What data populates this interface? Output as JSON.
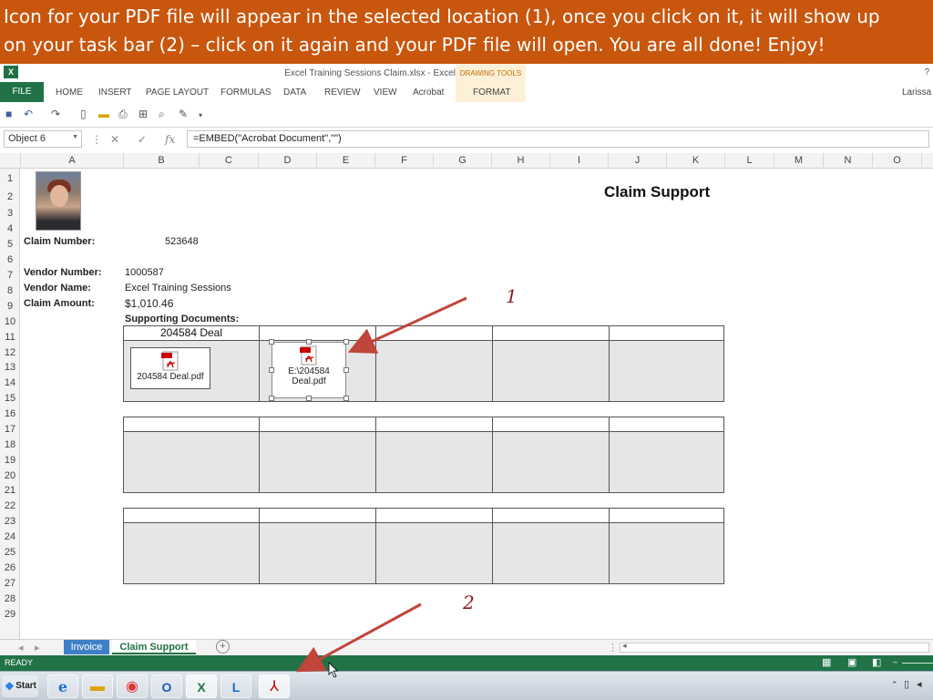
{
  "banner": {
    "line1": "Icon for your PDF file will appear in the selected location (1), once you click on it, it will show up",
    "line2": "on your task bar (2) – click on it again and your PDF file will open. You are all done!  Enjoy!"
  },
  "window": {
    "title": "Excel Training Sessions Claim.xlsx - Excel",
    "user": "Larissa",
    "help": "?"
  },
  "ribbon": {
    "file": "FILE",
    "tabs": [
      "HOME",
      "INSERT",
      "PAGE LAYOUT",
      "FORMULAS",
      "DATA",
      "REVIEW",
      "VIEW",
      "Acrobat",
      "FORMAT"
    ],
    "drawing_tools": "DRAWING TOOLS"
  },
  "formula_bar": {
    "name_box": "Object 6",
    "formula": "=EMBED(\"Acrobat Document\",\"\")",
    "fx": "fx"
  },
  "columns": [
    "A",
    "B",
    "C",
    "D",
    "E",
    "F",
    "G",
    "H",
    "I",
    "J",
    "K",
    "L",
    "M",
    "N",
    "O"
  ],
  "rows": [
    "1",
    "2",
    "3",
    "4",
    "5",
    "6",
    "7",
    "8",
    "9",
    "10",
    "11",
    "12",
    "13",
    "14",
    "15",
    "16",
    "17",
    "18",
    "19",
    "20",
    "21",
    "22",
    "23",
    "24",
    "25",
    "26",
    "27",
    "28",
    "29"
  ],
  "sheet": {
    "title": "Claim Support",
    "claim_number_label": "Claim Number:",
    "claim_number": "523648",
    "vendor_number_label": "Vendor Number:",
    "vendor_number": "1000587",
    "vendor_name_label": "Vendor Name:",
    "vendor_name": "Excel Training Sessions",
    "claim_amount_label": "Claim Amount:",
    "claim_amount": "$1,010.46",
    "supporting_docs_label": "Supporting Documents:",
    "table1_header": "204584 Deal",
    "pdf1_label": "204584 Deal.pdf",
    "pdf2_label": "E:\\204584 Deal.pdf",
    "pdf_badge": "PDF"
  },
  "annotations": {
    "marker1": "1",
    "marker2": "2"
  },
  "sheet_tabs": [
    "Invoice",
    "Claim Support"
  ],
  "status": {
    "ready": "READY"
  },
  "taskbar": {
    "start": "Start"
  },
  "colors": {
    "banner": "#c9560d",
    "excel_green": "#217346",
    "arrow": "#c0453a"
  }
}
